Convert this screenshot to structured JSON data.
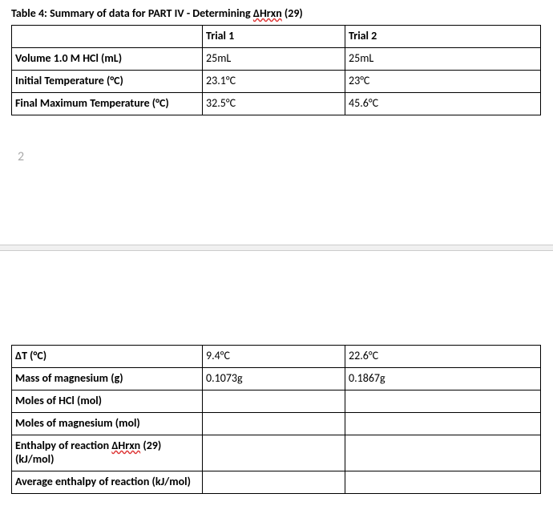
{
  "title_prefix": "Table 4: Summary of data for PART IV - Determining ",
  "title_delta": "ΔHrxn",
  "title_suffix": " (29)",
  "table1": {
    "headers": {
      "c1": "",
      "c2": "Trial 1",
      "c3": "Trial 2"
    },
    "rows": [
      {
        "label": "Volume 1.0 M HCl (mL)",
        "t1": "25mL",
        "t2": "25mL"
      },
      {
        "label": "Initial Temperature (°C)",
        "t1": "23.1°C",
        "t2": "23°C"
      },
      {
        "label": "Final Maximum Temperature (°C)",
        "t1": "32.5°C",
        "t2": "45.6°C"
      }
    ]
  },
  "page_number": "2",
  "table2": {
    "rows": [
      {
        "label": "ΔT (°C)",
        "t1": "9.4°C",
        "t2": "22.6°C"
      },
      {
        "label": "Mass of magnesium (g)",
        "t1": "0.1073g",
        "t2": "0.1867g"
      },
      {
        "label": "Moles of HCl (mol)",
        "t1": "",
        "t2": ""
      },
      {
        "label": "Moles of magnesium (mol)",
        "t1": "",
        "t2": ""
      },
      {
        "label_pre": "Enthalpy of reaction ",
        "label_red": "ΔHrxn",
        "label_post": " (29) (kJ/mol)",
        "t1": "",
        "t2": ""
      },
      {
        "label": "Average enthalpy of reaction (kJ/mol)",
        "t1": "",
        "t2": ""
      }
    ]
  }
}
